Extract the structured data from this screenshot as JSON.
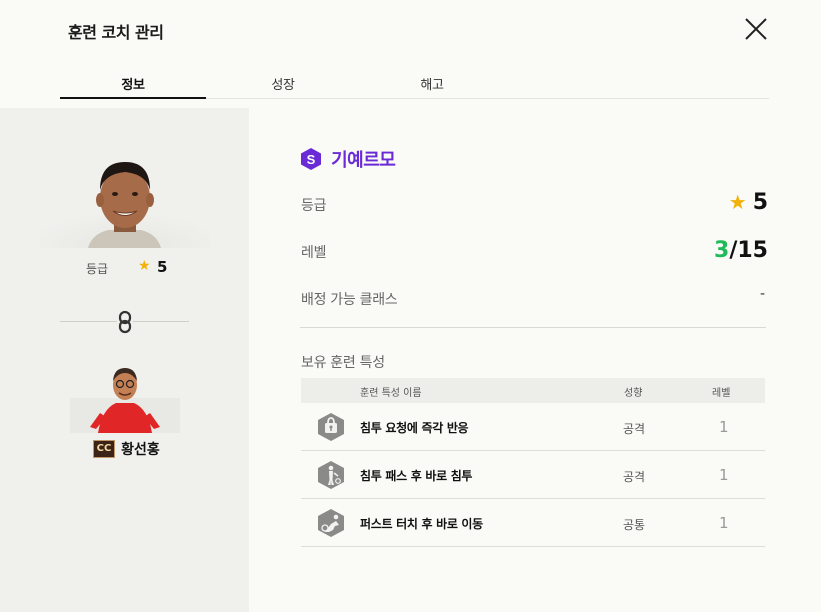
{
  "window": {
    "title": "훈련 코치 관리"
  },
  "tabs": [
    {
      "label": "정보",
      "active": true
    },
    {
      "label": "성장",
      "active": false
    },
    {
      "label": "해고",
      "active": false
    }
  ],
  "left": {
    "grade_label": "등급",
    "grade_value": "5",
    "coach_badge": "CC",
    "coach_name": "황선홍"
  },
  "program": {
    "badge_letter": "S",
    "name": "기예르모"
  },
  "info": {
    "grade_label": "등급",
    "grade_value": "5",
    "level_label": "레벨",
    "level_current": "3",
    "level_max": "/15",
    "class_label": "배정 가능 클래스",
    "class_value": "-"
  },
  "traits": {
    "section_title": "보유 훈련 특성",
    "headers": {
      "name": "훈련 특성 이름",
      "type": "성향",
      "level": "레벨"
    },
    "rows": [
      {
        "icon": "run-alert-icon",
        "name": "침투 요청에 즉각 반응",
        "type": "공격",
        "level": "1"
      },
      {
        "icon": "run-pass-icon",
        "name": "침투 패스 후 바로 침투",
        "type": "공격",
        "level": "1"
      },
      {
        "icon": "first-touch-icon",
        "name": "퍼스트 터치 후 바로 이동",
        "type": "공통",
        "level": "1"
      }
    ]
  },
  "colors": {
    "accent_purple": "#6a2bd6",
    "star_yellow": "#f2b20c",
    "level_green": "#1fba5a",
    "coach_badge_bg": "#3b2416"
  }
}
